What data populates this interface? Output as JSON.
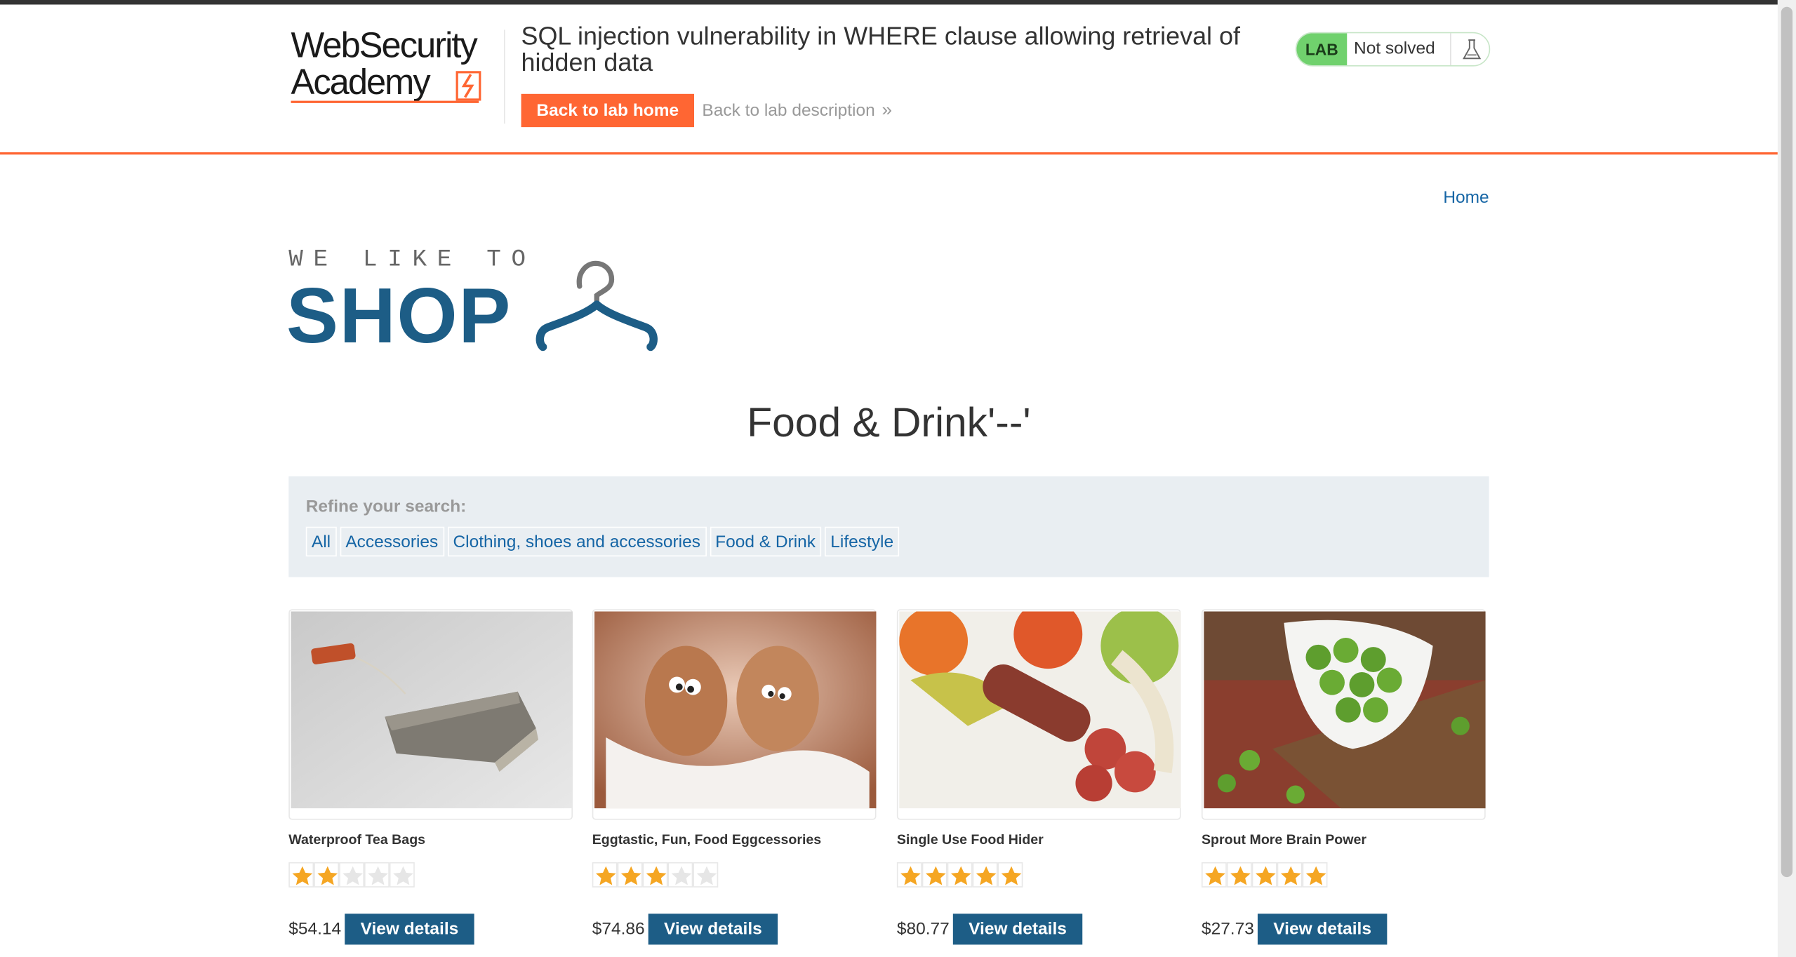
{
  "lab_header": {
    "logo_line1": "WebSecurity",
    "logo_line2": "Academy",
    "title": "SQL injection vulnerability in WHERE clause allowing retrieval of hidden data",
    "back_to_lab_home": "Back to lab home",
    "back_to_lab_description": "Back to lab description",
    "status_badge": "LAB",
    "status_text": "Not solved",
    "accent_color": "#ff6633",
    "status_color": "#70d16d"
  },
  "nav": {
    "home": "Home"
  },
  "shop_logo": {
    "tagline": "WE LIKE TO",
    "word": "SHOP",
    "brand_color": "#1d5d86"
  },
  "page_heading": "Food & Drink'--'",
  "filter": {
    "label": "Refine your search:",
    "categories": [
      "All",
      "Accessories",
      "Clothing, shoes and accessories",
      "Food & Drink",
      "Lifestyle"
    ]
  },
  "products": [
    {
      "name": "Waterproof Tea Bags",
      "rating": 2,
      "max_rating": 5,
      "price": "$54.14",
      "button": "View details",
      "image": "tea-bag-photo"
    },
    {
      "name": "Eggtastic, Fun, Food Eggcessories",
      "rating": 3,
      "max_rating": 5,
      "price": "$74.86",
      "button": "View details",
      "image": "eggs-photo"
    },
    {
      "name": "Single Use Food Hider",
      "rating": 5,
      "max_rating": 5,
      "price": "$80.77",
      "button": "View details",
      "image": "food-hider-photo"
    },
    {
      "name": "Sprout More Brain Power",
      "rating": 5,
      "max_rating": 5,
      "price": "$27.73",
      "button": "View details",
      "image": "sprouts-photo"
    }
  ]
}
